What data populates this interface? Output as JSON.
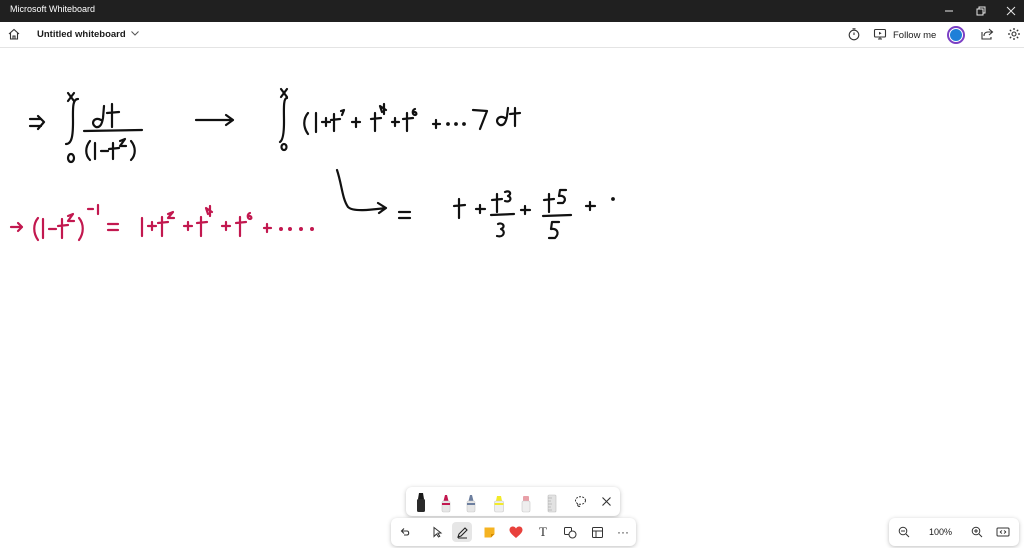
{
  "window": {
    "app_title": "Microsoft Whiteboard",
    "controls": [
      "minimize",
      "restore",
      "close"
    ]
  },
  "header": {
    "board_title": "Untitled whiteboard",
    "follow_label": "Follow me",
    "icons": [
      "home-icon",
      "chevron-down-icon",
      "timer-icon",
      "present-icon",
      "share-icon",
      "settings-icon"
    ]
  },
  "canvas": {
    "ink_colors": {
      "black": "#111111",
      "red": "#c2184f"
    }
  },
  "ink_toolbar": {
    "pens": [
      {
        "name": "black-pen",
        "color": "#1a1a1a",
        "selected": true
      },
      {
        "name": "red-pen",
        "color": "#c2184f"
      },
      {
        "name": "blue-pen",
        "color": "#7a8fb0"
      },
      {
        "name": "highlighter",
        "color": "#f2ea2a"
      },
      {
        "name": "eraser",
        "color": "#e8a0a8"
      },
      {
        "name": "ruler",
        "color": "#cfcfcf"
      }
    ]
  },
  "main_toolbar": {
    "tools": [
      "undo",
      "select",
      "inking",
      "sticky-note",
      "reactions",
      "text",
      "shapes",
      "templates",
      "more"
    ],
    "text_glyph": "T",
    "more_glyph": "···"
  },
  "zoom": {
    "level": "100%"
  }
}
